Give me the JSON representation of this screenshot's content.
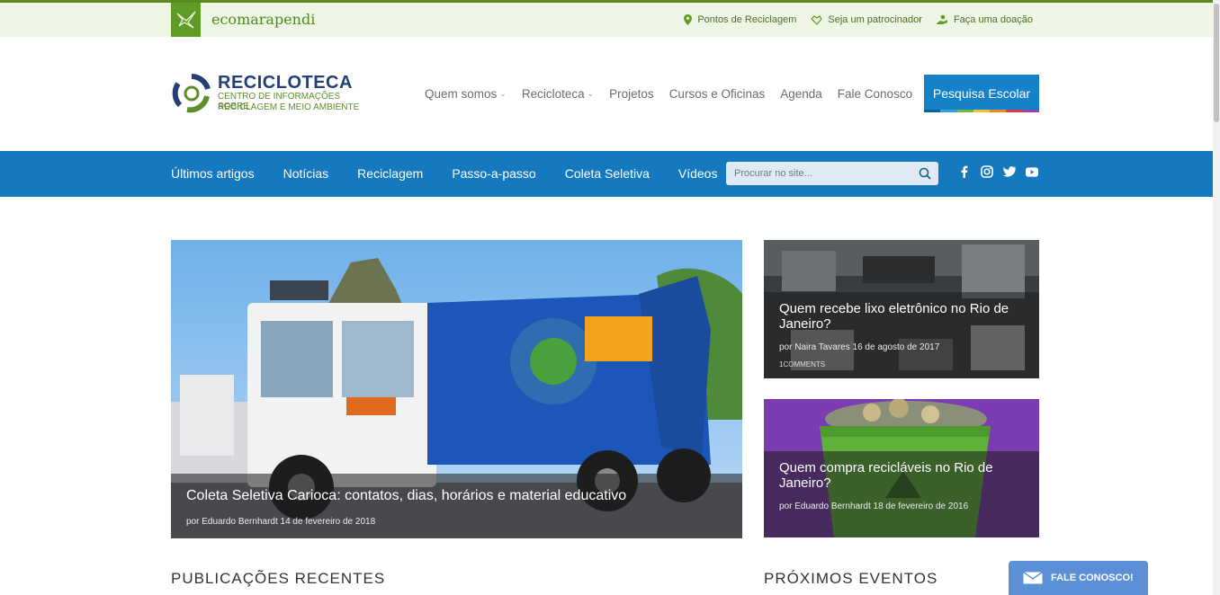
{
  "topbar": {
    "brand": "ecomarapendi",
    "links": [
      {
        "label": "Pontos de Reciclagem",
        "icon": "map-pin-icon"
      },
      {
        "label": "Seja um patrocinador",
        "icon": "handshake-icon"
      },
      {
        "label": "Faça uma doação",
        "icon": "donation-icon"
      }
    ]
  },
  "logo": {
    "title": "RECICLOTECA",
    "subtitle_line1": "CENTRO DE INFORMAÇÕES SOBRE",
    "subtitle_line2": "RECICLAGEM E MEIO AMBIENTE"
  },
  "main_nav": {
    "items": [
      "Quem somos",
      "Recicloteca",
      "Projetos",
      "Cursos e Oficinas",
      "Agenda",
      "Fale Conosco"
    ],
    "cta_label": "Pesquisa Escolar"
  },
  "blue_nav": {
    "items": [
      "Últimos artigos",
      "Notícias",
      "Reciclagem",
      "Passo-a-passo",
      "Coleta Seletiva",
      "Vídeos"
    ],
    "search_placeholder": "Procurar no site..."
  },
  "featured": {
    "main": {
      "title": "Coleta Seletiva Carioca: contatos, dias, horários e material educativo",
      "meta": "por Eduardo Bernhardt 14 de fevereiro de 2018"
    },
    "side": [
      {
        "title": "Quem recebe lixo eletrônico no Rio de Janeiro?",
        "meta": "por Naira Tavares 16 de agosto de 2017",
        "comments": "1COMMENTS"
      },
      {
        "title": "Quem compra recicláveis no Rio de Janeiro?",
        "meta": "por Eduardo Bernhardt 18 de fevereiro de 2016"
      }
    ]
  },
  "sections": {
    "recent": "PUBLICAÇÕES RECENTES",
    "events": "PRÓXIMOS EVENTOS"
  },
  "floating": {
    "contact_label": "FALE CONOSCO!"
  },
  "colors": {
    "green_accent": "#5e9b27",
    "blue_bar": "#1479bf",
    "cta_blue": "#1581c9",
    "navy_logo": "#233f73"
  }
}
